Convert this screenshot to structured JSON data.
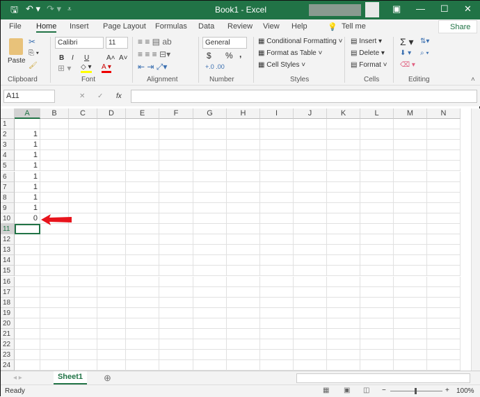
{
  "title": "Book1 - Excel",
  "qat": {
    "save": "🖫",
    "undo": "↶ ▾",
    "redo": "↷ ▾",
    "custom": "⩡"
  },
  "window": {
    "ribbon_display": "▣",
    "minimize": "—",
    "maximize": "☐",
    "close": "✕"
  },
  "tabs": [
    "File",
    "Home",
    "Insert",
    "Page Layout",
    "Formulas",
    "Data",
    "Review",
    "View",
    "Help"
  ],
  "tell_me": "Tell me",
  "share": "Share",
  "ribbon": {
    "clipboard": {
      "paste": "Paste",
      "label": "Clipboard"
    },
    "font": {
      "name": "Calibri",
      "size": "11",
      "bold": "B",
      "italic": "I",
      "underline": "U",
      "grow": "A˄",
      "shrink": "A˅",
      "label": "Font"
    },
    "alignment": {
      "label": "Alignment"
    },
    "number": {
      "format": "General",
      "currency": "$",
      "percent": "%",
      "comma": ",",
      "label": "Number"
    },
    "styles": {
      "conditional": "Conditional Formatting ˅",
      "table": "Format as Table ˅",
      "cell_styles": "Cell Styles ˅",
      "label": "Styles"
    },
    "cells": {
      "insert": "Insert",
      "delete": "Delete",
      "format": "Format ˅",
      "label": "Cells"
    },
    "editing": {
      "label": "Editing",
      "sum": "Σ"
    }
  },
  "formula_bar": {
    "name_box": "A11",
    "cancel": "✕",
    "enter": "✓",
    "fx": "fx",
    "value": ""
  },
  "columns": [
    "A",
    "B",
    "C",
    "D",
    "E",
    "F",
    "G",
    "H",
    "I",
    "J",
    "K",
    "L",
    "M",
    "N"
  ],
  "rows": [
    "1",
    "2",
    "3",
    "4",
    "5",
    "6",
    "7",
    "8",
    "9",
    "10",
    "11",
    "12",
    "13",
    "14",
    "15",
    "16",
    "17",
    "18",
    "19",
    "20",
    "21",
    "22",
    "23",
    "24"
  ],
  "cells_A": [
    "",
    "1",
    "1",
    "1",
    "1",
    "1",
    "1",
    "1",
    "1",
    "0"
  ],
  "selected_cell": "A11",
  "sheet_tab": "Sheet1",
  "add_sheet": "⊕",
  "status": {
    "ready": "Ready",
    "zoom": "100%",
    "minus": "−",
    "plus": "+"
  },
  "colors": {
    "accent": "#217346",
    "arrow": "#e8141c"
  }
}
